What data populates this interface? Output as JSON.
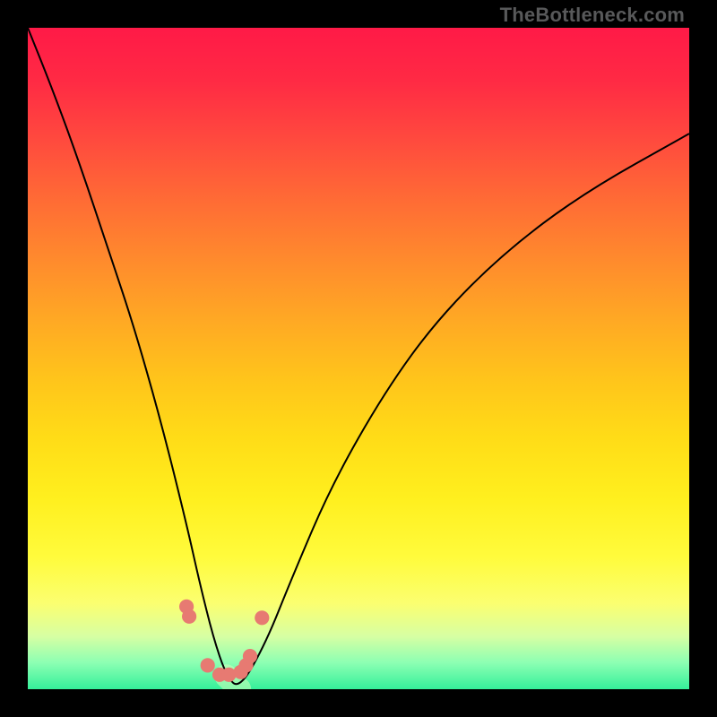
{
  "watermark": "TheBottleneck.com",
  "colors": {
    "background_frame": "#000000",
    "curve": "#000000",
    "marker": "#e77a72",
    "watermark": "#58595a"
  },
  "chart_data": {
    "type": "line",
    "title": "",
    "xlabel": "",
    "ylabel": "",
    "xlim": [
      0,
      100
    ],
    "ylim": [
      0,
      100
    ],
    "axes_visible": false,
    "grid": false,
    "legend": false,
    "note": "Values are visual estimates from the rendered curve; no numeric axes are shown.",
    "series": [
      {
        "name": "bottleneck-curve",
        "x": [
          0,
          4,
          8,
          12,
          16,
          20,
          24,
          26,
          28,
          30,
          32,
          36,
          40,
          46,
          54,
          62,
          72,
          84,
          100
        ],
        "values": [
          100,
          90,
          79,
          67,
          55,
          41,
          25,
          16,
          8,
          2,
          0,
          7,
          17,
          31,
          45,
          56,
          66,
          75,
          84
        ]
      }
    ],
    "markers": [
      {
        "x": 24.0,
        "y": 12.5,
        "r": 1.1
      },
      {
        "x": 24.4,
        "y": 11.0,
        "r": 1.1
      },
      {
        "x": 27.2,
        "y": 3.6,
        "r": 1.1
      },
      {
        "x": 29.0,
        "y": 2.2,
        "r": 1.1
      },
      {
        "x": 30.4,
        "y": 2.2,
        "r": 1.1
      },
      {
        "x": 32.2,
        "y": 2.6,
        "r": 1.1
      },
      {
        "x": 33.0,
        "y": 3.6,
        "r": 1.1
      },
      {
        "x": 33.6,
        "y": 5.0,
        "r": 1.1
      },
      {
        "x": 35.4,
        "y": 10.8,
        "r": 1.1
      }
    ]
  }
}
